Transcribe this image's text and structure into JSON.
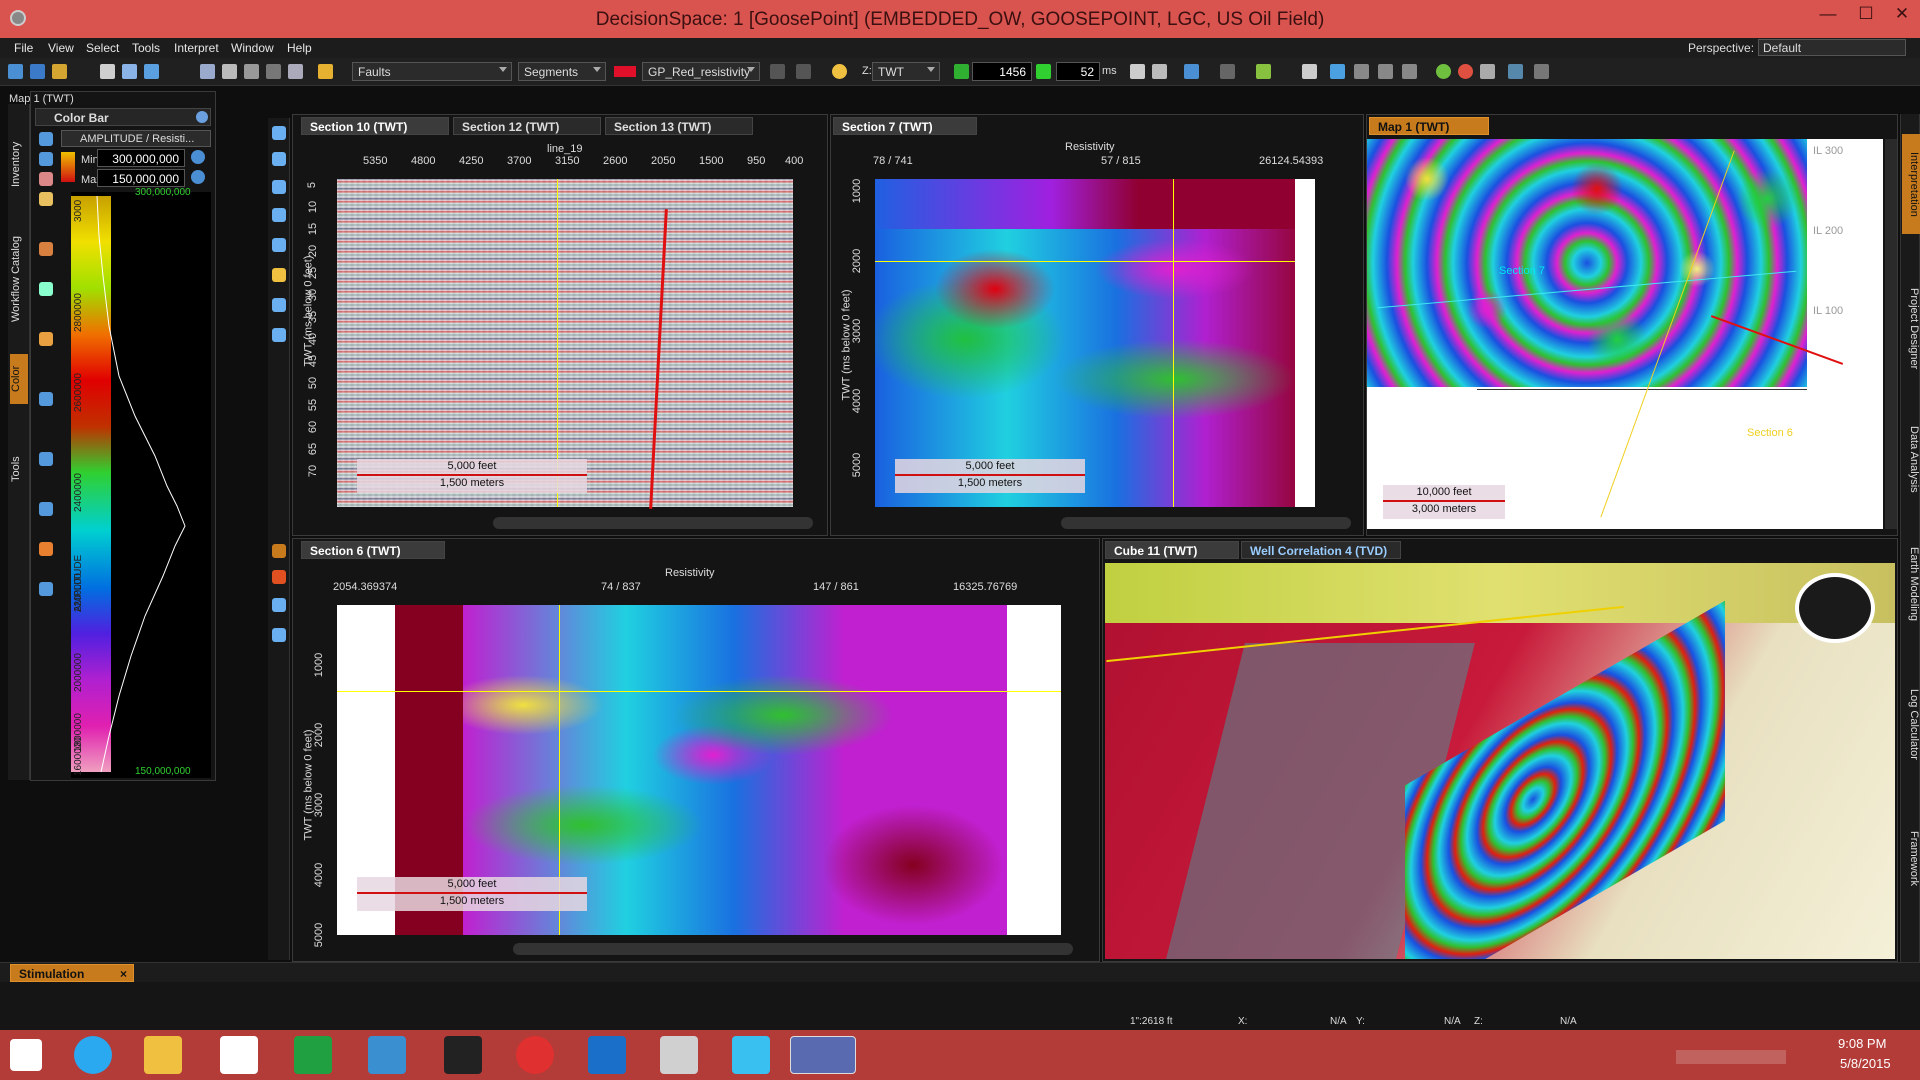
{
  "window": {
    "title": "DecisionSpace: 1 [GoosePoint] (EMBEDDED_OW, GOOSEPOINT, LGC, US Oil Field)",
    "minimize": "—",
    "maximize": "☐",
    "close": "✕"
  },
  "menu": {
    "items": [
      "File",
      "View",
      "Select",
      "Tools",
      "Interpret",
      "Window",
      "Help"
    ],
    "perspective_label": "Perspective:",
    "perspective_value": "Default"
  },
  "toolbar": {
    "faults": "Faults",
    "segments": "Segments",
    "colormap": "GP_Red_resistivity",
    "domain": "TWT",
    "domain_prefix": "Z:",
    "time_value": "1456",
    "step_value": "52",
    "step_unit": "ms",
    "colormap_swatch": "#e0102a"
  },
  "left_panel": {
    "title": "Map 1 (TWT)",
    "color_bar_title": "Color Bar",
    "attribute": "AMPLITUDE / Resisti...",
    "min_label": "Min",
    "min_value": "300,000,000",
    "max_label": "Max",
    "max_value": "150,000,000",
    "top_value": "300,000,000",
    "bottom_value": "150,000,000",
    "axis_label": "AMPLITUDE",
    "ticks": [
      "3000",
      "2800000",
      "2600000",
      "2400000",
      "2200000",
      "2000000",
      "1800000",
      "1600000"
    ],
    "side_tabs": [
      "Inventory",
      "Workflow Catalog",
      "Color",
      "Tools"
    ]
  },
  "right_side_tabs": [
    "Interpretation",
    "Project Designer",
    "Data Analysis",
    "Earth Modeling",
    "Log Calculator",
    "Framework"
  ],
  "section10": {
    "tabs": [
      "Section 10 (TWT)",
      "Section 12 (TWT)",
      "Section 13 (TWT)"
    ],
    "line_label": "line_19",
    "xticks": [
      "5350",
      "4800",
      "4250",
      "3700",
      "3150",
      "2600",
      "2050",
      "1500",
      "950",
      "400"
    ],
    "yticks": [
      "5",
      "10",
      "15",
      "20",
      "25",
      "30",
      "35",
      "40",
      "45",
      "50",
      "55",
      "60",
      "65",
      "70"
    ],
    "ylabel": "TWT (ms below 0 feet)",
    "scale_top": "5,000 feet",
    "scale_bottom": "1,500 meters"
  },
  "section7": {
    "tab": "Section 7 (TWT)",
    "attr_label": "Resistivity",
    "xticks": [
      "78 / 741",
      "57 / 815",
      "26124.54393"
    ],
    "yticks": [
      "1000",
      "2000",
      "3000",
      "4000",
      "5000"
    ],
    "ylabel": "TWT (ms below 0 feet)",
    "scale_top": "5,000 feet",
    "scale_bottom": "1,500 meters"
  },
  "map1": {
    "tab": "Map 1 (TWT)",
    "il_labels": [
      "IL 300",
      "IL 200",
      "IL 100"
    ],
    "section_labels": [
      "Section 7",
      "Section 6"
    ],
    "scale_top": "10,000 feet",
    "scale_bottom": "3,000 meters"
  },
  "section6": {
    "tab": "Section 6 (TWT)",
    "attr_label": "Resistivity",
    "xticks": [
      "2054.369374",
      "74 / 837",
      "147 / 861",
      "16325.76769"
    ],
    "yticks": [
      "1000",
      "2000",
      "3000",
      "4000",
      "5000"
    ],
    "ylabel": "TWT (ms below 0 feet)",
    "scale_top": "5,000 feet",
    "scale_bottom": "1,500 meters"
  },
  "cube": {
    "tabs": [
      "Cube 11 (TWT)",
      "Well Correlation 4 (TVD)"
    ]
  },
  "bottom": {
    "tab": "Stimulation",
    "tab_close": "×",
    "readout_prefix": "1\":2618 ft",
    "x_label": "X:",
    "x_value": "N/A",
    "y_label": "Y:",
    "y_value": "N/A",
    "z_label": "Z:",
    "z_value": "N/A"
  },
  "taskbar": {
    "time": "9:08 PM",
    "date": "5/8/2015"
  }
}
